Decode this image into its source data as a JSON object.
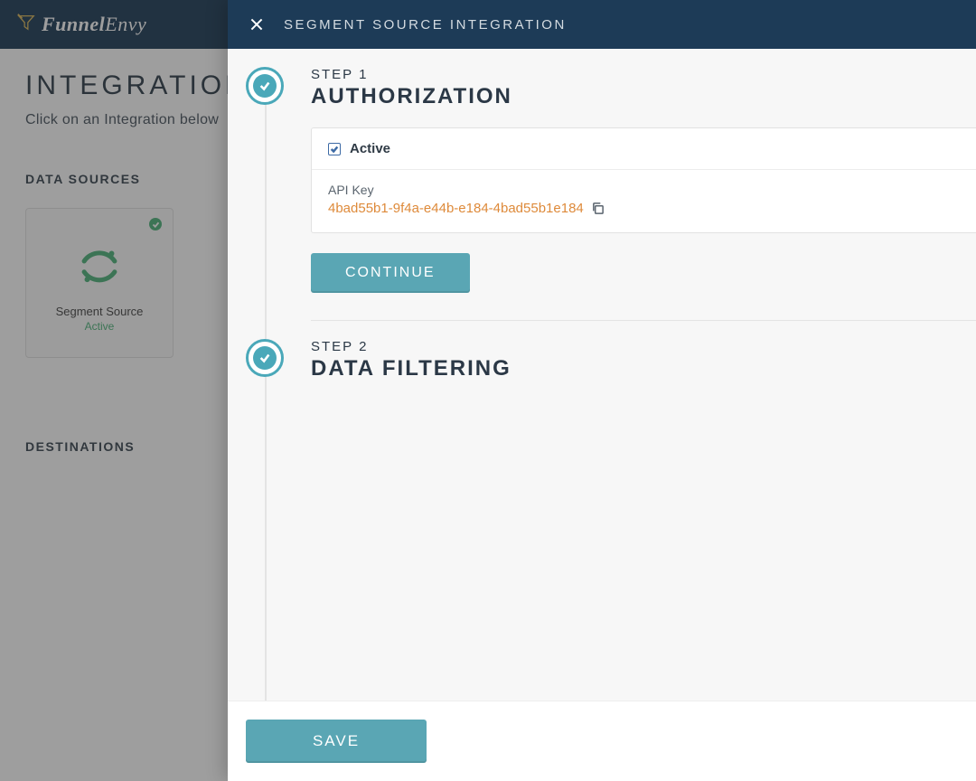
{
  "brand": {
    "name_a": "Funnel",
    "name_b": "Envy"
  },
  "background": {
    "title": "INTEGRATIONS",
    "subtitle": "Click on an Integration below",
    "sections": {
      "data_sources_label": "DATA SOURCES",
      "destinations_label": "DESTINATIONS"
    },
    "card": {
      "name": "Segment Source",
      "status": "Active"
    }
  },
  "panel": {
    "title": "SEGMENT SOURCE INTEGRATION",
    "steps": [
      {
        "label": "STEP 1",
        "title": "AUTHORIZATION",
        "active_checkbox_label": "Active",
        "active_checked": true,
        "api_key_label": "API Key",
        "api_key_value": "4bad55b1-9f4a-e44b-e184-4bad55b1e184",
        "continue_label": "CONTINUE"
      },
      {
        "label": "STEP 2",
        "title": "DATA FILTERING"
      }
    ],
    "save_label": "SAVE"
  },
  "colors": {
    "header": "#1d3b57",
    "accent": "#5aa6b4",
    "success": "#4db27a",
    "api_text": "#de8a3a"
  }
}
